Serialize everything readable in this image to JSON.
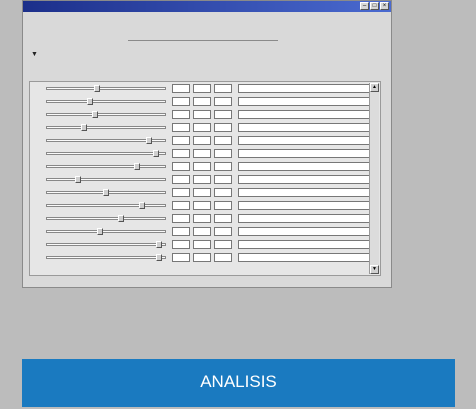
{
  "window": {
    "title": "",
    "menu": [
      "",
      ""
    ]
  },
  "headline": "",
  "columns": {
    "scale": "",
    "value1": "",
    "value2": "",
    "description": ""
  },
  "rows": [
    {
      "n": "",
      "pos": 0.42,
      "v1": "",
      "v2": "",
      "v3": "",
      "d": ""
    },
    {
      "n": "",
      "pos": 0.36,
      "v1": "",
      "v2": "",
      "v3": "",
      "d": ""
    },
    {
      "n": "",
      "pos": 0.4,
      "v1": "",
      "v2": "",
      "v3": "",
      "d": ""
    },
    {
      "n": "",
      "pos": 0.3,
      "v1": "",
      "v2": "",
      "v3": "",
      "d": ""
    },
    {
      "n": "",
      "pos": 0.88,
      "v1": "",
      "v2": "",
      "v3": "",
      "d": ""
    },
    {
      "n": "",
      "pos": 0.95,
      "v1": "",
      "v2": "",
      "v3": "",
      "d": ""
    },
    {
      "n": "",
      "pos": 0.78,
      "v1": "",
      "v2": "",
      "v3": "",
      "d": ""
    },
    {
      "n": "",
      "pos": 0.25,
      "v1": "",
      "v2": "",
      "v3": "",
      "d": ""
    },
    {
      "n": "",
      "pos": 0.5,
      "v1": "",
      "v2": "",
      "v3": "",
      "d": ""
    },
    {
      "n": "",
      "pos": 0.82,
      "v1": "",
      "v2": "",
      "v3": "",
      "d": ""
    },
    {
      "n": "",
      "pos": 0.63,
      "v1": "",
      "v2": "",
      "v3": "",
      "d": ""
    },
    {
      "n": "",
      "pos": 0.45,
      "v1": "",
      "v2": "",
      "v3": "",
      "d": ""
    },
    {
      "n": "",
      "pos": 0.97,
      "v1": "",
      "v2": "",
      "v3": "",
      "d": ""
    },
    {
      "n": "",
      "pos": 0.97,
      "v1": "",
      "v2": "",
      "v3": "",
      "d": ""
    }
  ],
  "banner": "ANALISIS",
  "colors": {
    "banner": "#1a7ac0",
    "titlebar": "#1c2f8a"
  },
  "icons": {
    "scroll_up": "triangle-up-icon",
    "scroll_down": "triangle-down-icon",
    "column": "arrow-down-icon"
  }
}
